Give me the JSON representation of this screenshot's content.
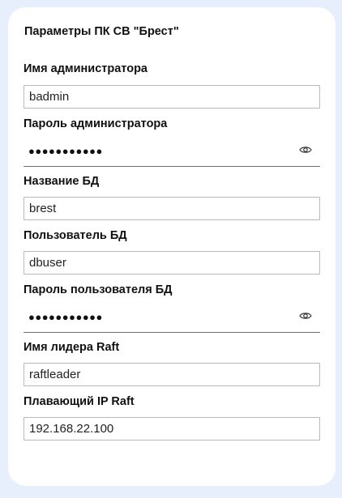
{
  "panel": {
    "title": "Параметры ПК СВ \"Брест\""
  },
  "fields": {
    "admin_name": {
      "label": "Имя администратора",
      "value": "badmin"
    },
    "admin_password": {
      "label": "Пароль администратора",
      "masked_value": "●●●●●●●●●●●",
      "icon": "eye-icon"
    },
    "db_name": {
      "label": "Название БД",
      "value": "brest"
    },
    "db_user": {
      "label": "Пользователь БД",
      "value": "dbuser"
    },
    "db_user_password": {
      "label": "Пароль пользователя БД",
      "masked_value": "●●●●●●●●●●●",
      "icon": "eye-icon"
    },
    "raft_leader": {
      "label": "Имя лидера Raft",
      "value": "raftleader"
    },
    "raft_floating_ip": {
      "label": "Плавающий IP Raft",
      "value": "192.168.22.100"
    }
  },
  "colors": {
    "page_background": "#e8effc",
    "card_background": "#ffffff",
    "input_border": "#b9b9b9",
    "password_underline": "#6f6f6f"
  }
}
